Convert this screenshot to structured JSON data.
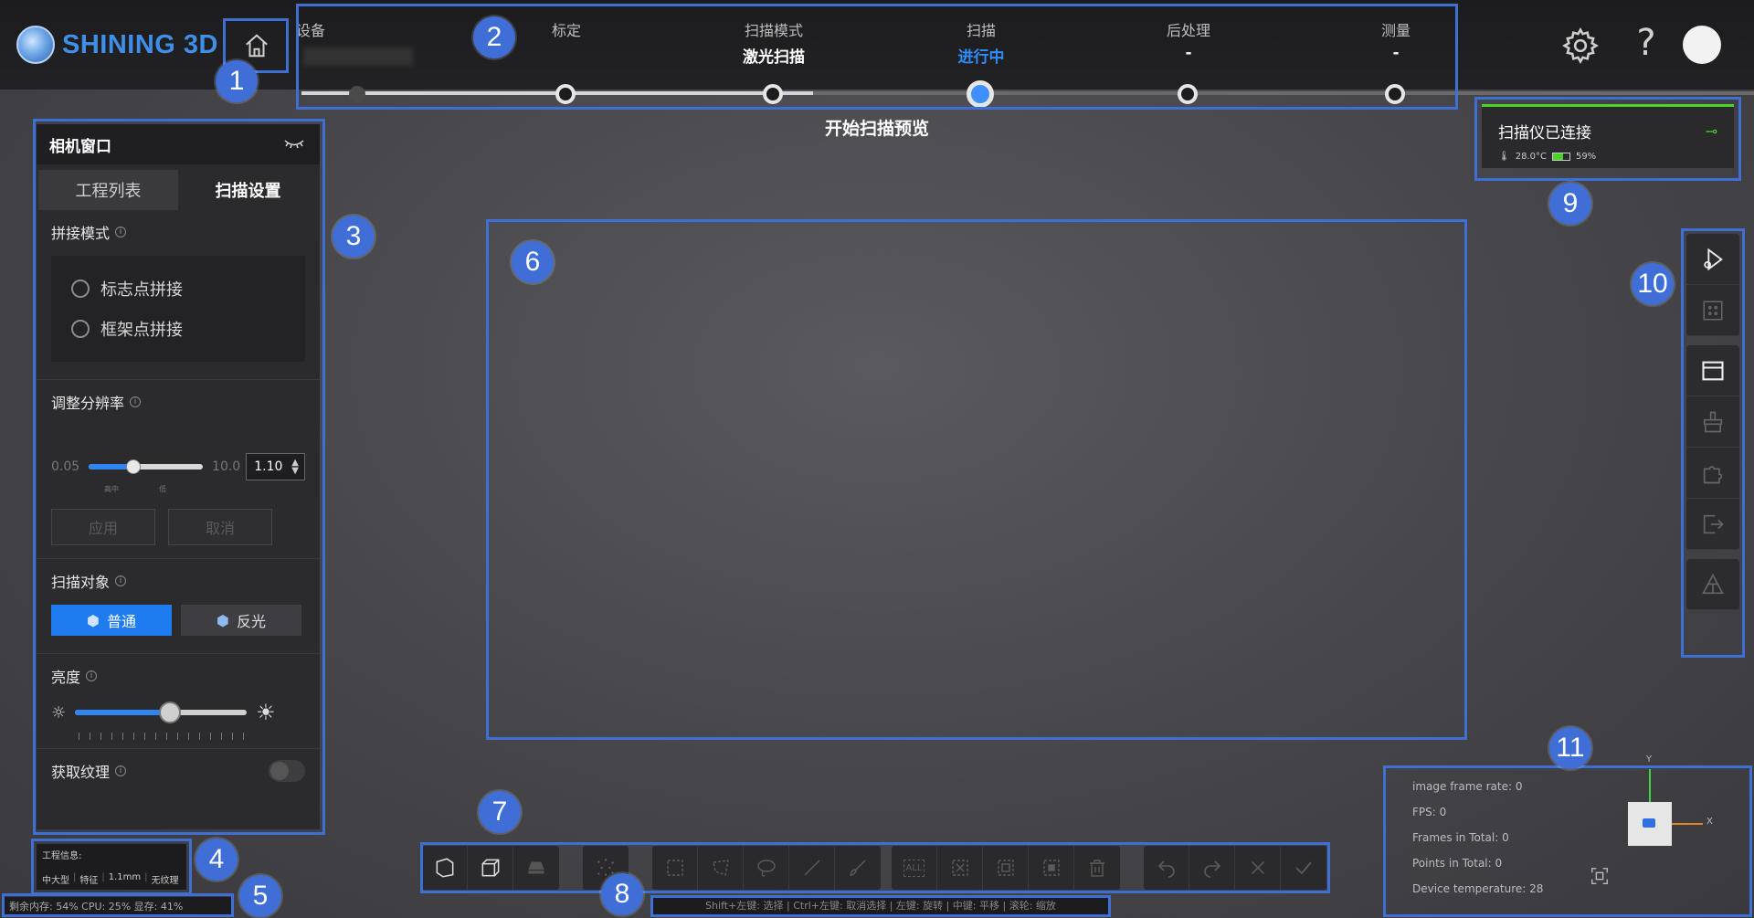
{
  "brand": {
    "name": "SHINING 3D"
  },
  "steps": [
    {
      "label": "设备",
      "value": ""
    },
    {
      "label": "标定",
      "value": ""
    },
    {
      "label": "扫描模式",
      "value": "激光扫描"
    },
    {
      "label": "扫描",
      "value": "进行中"
    },
    {
      "label": "后处理",
      "value": "-"
    },
    {
      "label": "测量",
      "value": "-"
    }
  ],
  "preview_title": "开始扫描预览",
  "camera_window": {
    "title": "相机窗口",
    "tabs": [
      "工程列表",
      "扫描设置"
    ],
    "stitch": {
      "title": "拼接模式",
      "options": [
        "标志点拼接",
        "框架点拼接"
      ]
    },
    "resolution": {
      "title": "调整分辨率",
      "min": "0.05",
      "max": "10.0",
      "value": "1.10",
      "level": 0.38,
      "mini_labels": [
        "高中",
        "低"
      ],
      "apply": "应用",
      "cancel": "取消"
    },
    "scan_object": {
      "title": "扫描对象",
      "normal": "普通",
      "reflective": "反光"
    },
    "brightness": {
      "title": "亮度",
      "level": 0.55
    },
    "texture": {
      "title": "获取纹理"
    }
  },
  "project_info": {
    "title": "工程信息:",
    "tags": [
      "中大型",
      "特征",
      "1.1mm",
      "无纹理"
    ]
  },
  "status": "剩余内存: 54% CPU: 25% 显存: 41%",
  "connection": {
    "title": "扫描仪已连接",
    "temperature": "28.0°C",
    "battery": "59%",
    "battery_level": 0.59,
    "color": "#4bd32a"
  },
  "shortcut_hint": "Shift+左键: 选择 | Ctrl+左键: 取消选择 | 左键: 旋转 | 中键: 平移 | 滚轮: 缩放",
  "device_info": {
    "lines": [
      "image frame rate: 0",
      "FPS: 0",
      "Frames in Total: 0",
      "Points in Total: 0",
      "Device temperature: 28"
    ],
    "axis_y": "Y",
    "axis_x": "X"
  },
  "callouts": [
    "1",
    "2",
    "3",
    "4",
    "5",
    "6",
    "7",
    "8",
    "9",
    "10",
    "11"
  ],
  "colors": {
    "accent": "#1f7cf0",
    "highlight": "#3d6fd4",
    "connected": "#4bd32a"
  }
}
